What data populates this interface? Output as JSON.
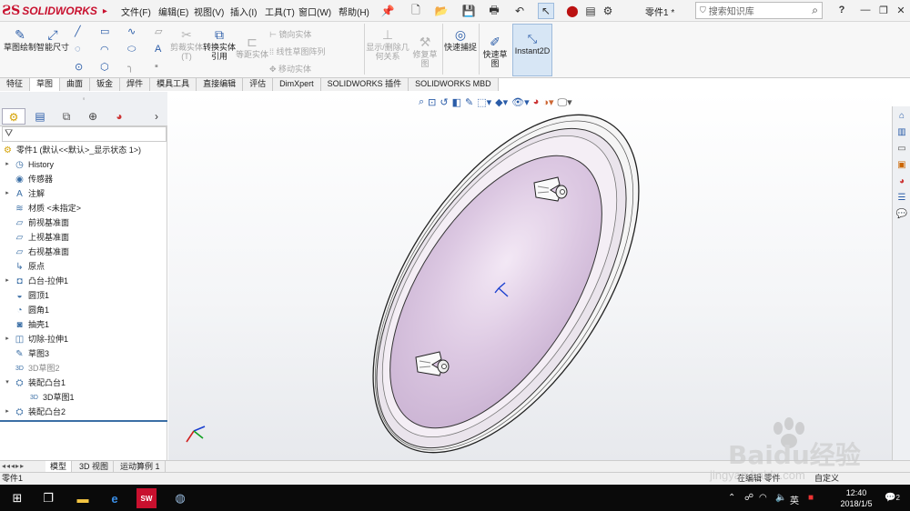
{
  "app": {
    "logo_text": "SOLIDWORKS",
    "menu": [
      "文件(F)",
      "编辑(E)",
      "视图(V)",
      "插入(I)",
      "工具(T)",
      "窗口(W)",
      "帮助(H)"
    ],
    "part_title": "零件1 *",
    "search_placeholder": "搜索知识库",
    "help_label": "?"
  },
  "ribbon": {
    "sketch": "草图绘制",
    "smart_dim": "智能尺寸",
    "trim": "剪裁实体(T)",
    "convert": "转换实体引用",
    "offset": "等距实体",
    "mirror": "镜向实体",
    "linear_pattern": "线性草图阵列",
    "move": "移动实体",
    "show_relations": "显示/删除几何关系",
    "repair": "修复草图",
    "quick_snap": "快速捕捉",
    "quick_sketch": "快速草图",
    "instant2d": "Instant2D"
  },
  "tabs": [
    "特征",
    "草图",
    "曲面",
    "钣金",
    "焊件",
    "模具工具",
    "直接编辑",
    "评估",
    "DimXpert",
    "SOLIDWORKS 插件",
    "SOLIDWORKS MBD"
  ],
  "active_tab": "草图",
  "tree": {
    "root": "零件1 (默认<<默认>_显示状态 1>)",
    "items": [
      {
        "label": "History",
        "icon": "history-icon",
        "exp": "▸"
      },
      {
        "label": "传感器",
        "icon": "sensor-icon",
        "exp": ""
      },
      {
        "label": "注解",
        "icon": "annotation-icon",
        "exp": "▸"
      },
      {
        "label": "材质 <未指定>",
        "icon": "material-icon",
        "exp": ""
      },
      {
        "label": "前视基准面",
        "icon": "plane-icon",
        "exp": ""
      },
      {
        "label": "上视基准面",
        "icon": "plane-icon",
        "exp": ""
      },
      {
        "label": "右视基准面",
        "icon": "plane-icon",
        "exp": ""
      },
      {
        "label": "原点",
        "icon": "origin-icon",
        "exp": ""
      },
      {
        "label": "凸台-拉伸1",
        "icon": "extrude-icon",
        "exp": "▸"
      },
      {
        "label": "圆顶1",
        "icon": "dome-icon",
        "exp": ""
      },
      {
        "label": "圆角1",
        "icon": "fillet-icon",
        "exp": ""
      },
      {
        "label": "抽壳1",
        "icon": "shell-icon",
        "exp": ""
      },
      {
        "label": "切除-拉伸1",
        "icon": "cut-icon",
        "exp": "▸"
      },
      {
        "label": "草图3",
        "icon": "sketch-icon",
        "exp": ""
      },
      {
        "label": "3D草图2",
        "icon": "3dsketch-icon",
        "exp": "",
        "dim": true
      },
      {
        "label": "装配凸台1",
        "icon": "mount-boss-icon",
        "exp": "▾"
      },
      {
        "label": "3D草图1",
        "icon": "3dsketch-icon",
        "exp": "",
        "child": true
      },
      {
        "label": "装配凸台2",
        "icon": "mount-boss-icon",
        "exp": "▸"
      }
    ]
  },
  "bottom_tabs": [
    "模型",
    "3D 视图",
    "运动算例 1"
  ],
  "active_bottom_tab": "模型",
  "status": {
    "left": "零件1",
    "right1": "在编辑 零件",
    "right2": "自定义"
  },
  "taskbar": {
    "time": "12:40",
    "date": "2018/1/5",
    "ime": "英",
    "notification_count": "2"
  },
  "watermark": {
    "brand": "Baidu经验",
    "url": "jingyan.baidu.com"
  },
  "colors": {
    "accent": "#2a5ca8",
    "solidworks_red": "#c8102e",
    "part_fill": "#dcc8e2"
  }
}
